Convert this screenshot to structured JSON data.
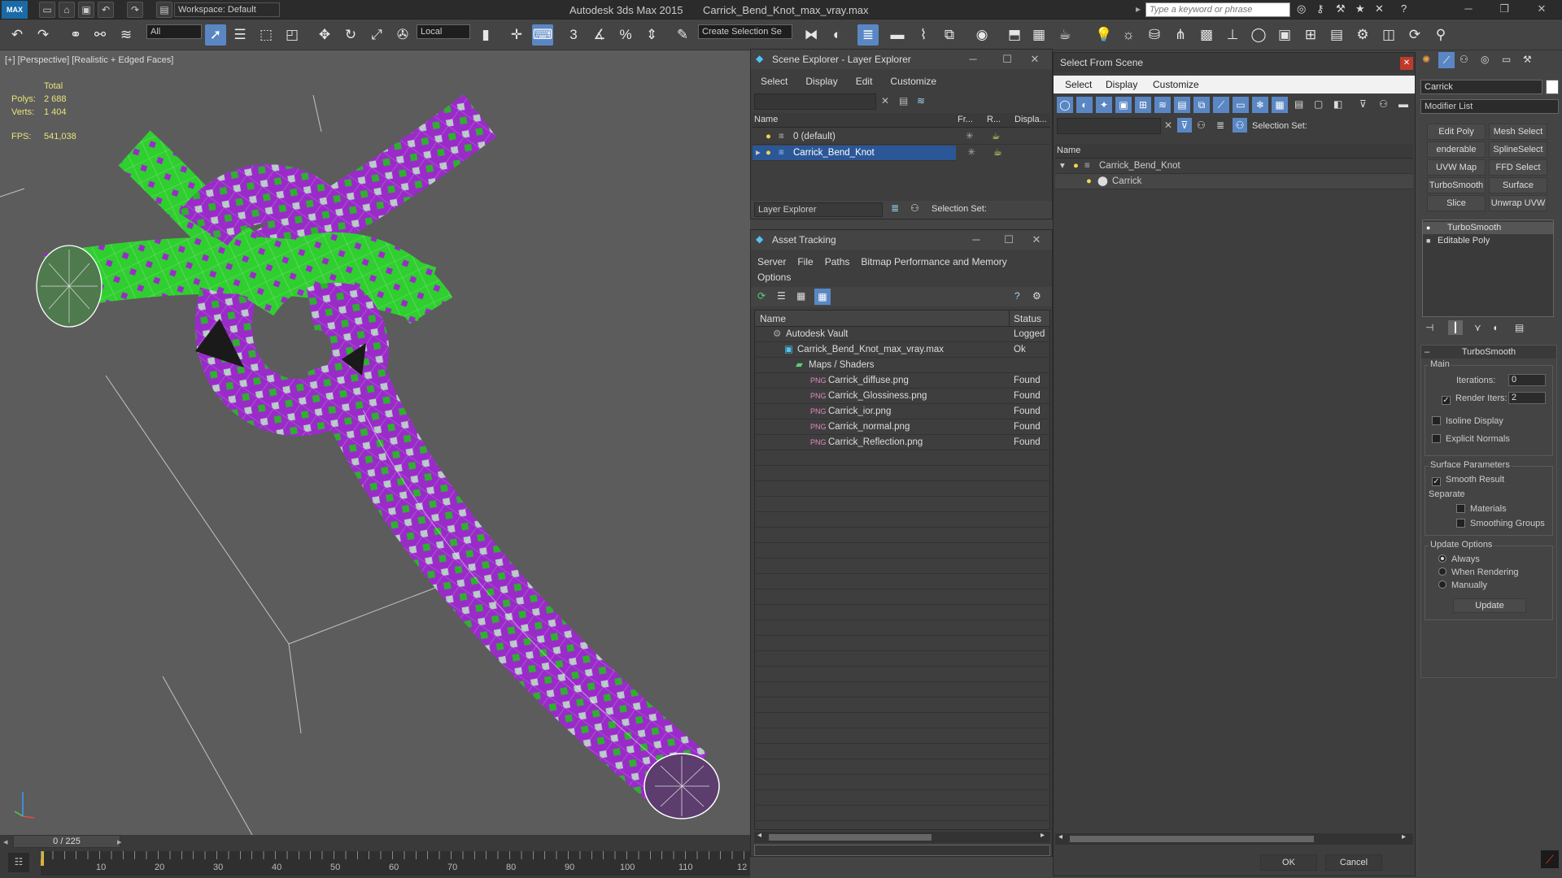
{
  "app": {
    "title": "Autodesk 3ds Max  2015",
    "file": "Carrick_Bend_Knot_max_vray.max",
    "workspace": "Workspace: Default",
    "search_placeholder": "Type a keyword or phrase",
    "logo": "MAX"
  },
  "toolbar": {
    "selection_filter": "All",
    "coord_system": "Local",
    "selection_set": "Create Selection Se"
  },
  "viewport": {
    "label": "[+] [Perspective] [Realistic + Edged Faces]",
    "stats_total": "Total",
    "polys_label": "Polys:",
    "polys_value": "2 688",
    "verts_label": "Verts:",
    "verts_value": "1 404",
    "fps_label": "FPS:",
    "fps_value": "541,038",
    "colors": {
      "green": "#2fd62f",
      "purple": "#9a2bc9",
      "wire": "#ffffff",
      "bg": "#5c5c5c"
    }
  },
  "timeline": {
    "frame": "0 / 225",
    "ticks": [
      "10",
      "20",
      "30",
      "40",
      "50",
      "60",
      "70",
      "80",
      "90",
      "100",
      "110",
      "12"
    ]
  },
  "scene_explorer": {
    "title": "Scene Explorer - Layer Explorer",
    "menu": [
      "Select",
      "Display",
      "Edit",
      "Customize"
    ],
    "columns": [
      "Name",
      "Fr...",
      "R...",
      "Displa..."
    ],
    "rows": [
      {
        "name": "0 (default)",
        "selected": false
      },
      {
        "name": "Carrick_Bend_Knot",
        "selected": true
      }
    ],
    "footer_combo": "Layer Explorer",
    "selection_set_label": "Selection Set:"
  },
  "asset_tracking": {
    "title": "Asset Tracking",
    "menu": [
      "Server",
      "File",
      "Paths",
      "Bitmap Performance and Memory",
      "Options"
    ],
    "columns": [
      "Name",
      "Status"
    ],
    "rows": [
      {
        "name": "Autodesk Vault",
        "status": "Logged",
        "level": 1,
        "icon": "vault-icon"
      },
      {
        "name": "Carrick_Bend_Knot_max_vray.max",
        "status": "Ok",
        "level": 2,
        "icon": "max-file-icon"
      },
      {
        "name": "Maps / Shaders",
        "status": "",
        "level": 3,
        "icon": "maps-icon"
      },
      {
        "name": "Carrick_diffuse.png",
        "status": "Found",
        "level": 4,
        "icon": "png-icon"
      },
      {
        "name": "Carrick_Glossiness.png",
        "status": "Found",
        "level": 4,
        "icon": "png-icon"
      },
      {
        "name": "Carrick_ior.png",
        "status": "Found",
        "level": 4,
        "icon": "png-icon"
      },
      {
        "name": "Carrick_normal.png",
        "status": "Found",
        "level": 4,
        "icon": "png-icon"
      },
      {
        "name": "Carrick_Reflection.png",
        "status": "Found",
        "level": 4,
        "icon": "png-icon"
      }
    ]
  },
  "select_from_scene": {
    "title": "Select From Scene",
    "menu": [
      "Select",
      "Display",
      "Customize"
    ],
    "selection_set_label": "Selection Set:",
    "column": "Name",
    "tree": [
      {
        "name": "Carrick_Bend_Knot",
        "level": 1
      },
      {
        "name": "Carrick",
        "level": 2
      }
    ],
    "ok": "OK",
    "cancel": "Cancel"
  },
  "command_panel": {
    "object_name": "Carrick",
    "modifier_list": "Modifier List",
    "buttons": [
      "Edit Poly",
      "Mesh Select",
      "enderable Splir",
      "SplineSelect",
      "UVW Map",
      "FFD Select",
      "TurboSmooth",
      "Surface Select",
      "Slice",
      "Unwrap UVW"
    ],
    "stack": [
      "TurboSmooth",
      "Editable Poly"
    ],
    "rollout_title": "TurboSmooth",
    "main_label": "Main",
    "iterations_label": "Iterations:",
    "iterations_value": "0",
    "render_iters_label": "Render Iters:",
    "render_iters_value": "2",
    "isoline_label": "Isoline Display",
    "explicit_label": "Explicit Normals",
    "surface_label": "Surface Parameters",
    "smooth_label": "Smooth Result",
    "separate_label": "Separate",
    "materials_label": "Materials",
    "smoothing_label": "Smoothing Groups",
    "update_options_label": "Update Options",
    "always_label": "Always",
    "when_rendering_label": "When Rendering",
    "manually_label": "Manually",
    "update_button": "Update"
  }
}
